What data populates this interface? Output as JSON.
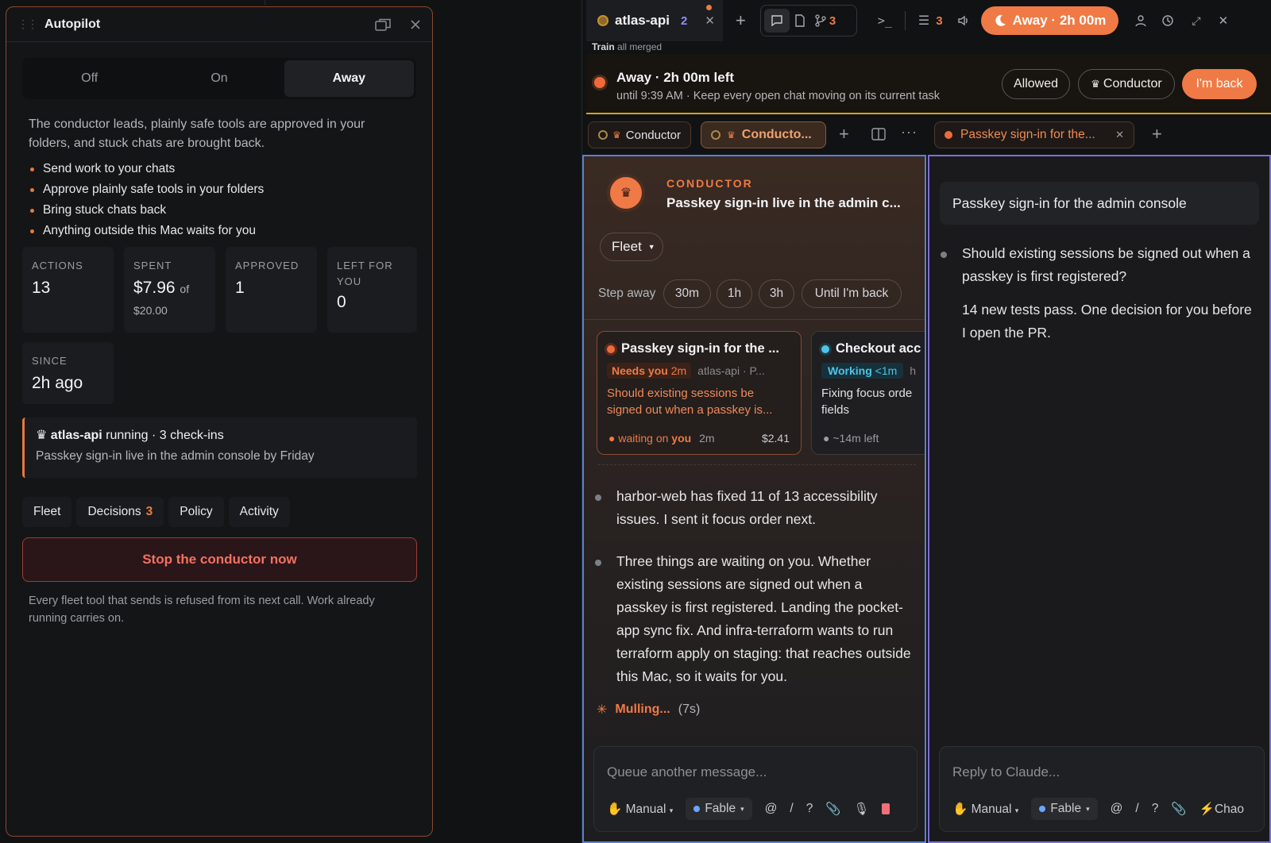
{
  "autopilot": {
    "title": "Autopilot",
    "modes": [
      "Off",
      "On",
      "Away"
    ],
    "selected_mode": "Away",
    "description": "The conductor leads, plainly safe tools are approved in your folders, and stuck chats are brought back.",
    "bullets": [
      "Send work to your chats",
      "Approve plainly safe tools in your folders",
      "Bring stuck chats back",
      "Anything outside this Mac waits for you"
    ],
    "stats": {
      "actions": {
        "label": "ACTIONS",
        "value": "13"
      },
      "spent": {
        "label": "SPENT",
        "value": "$7.96",
        "of_label": "of",
        "total": "$20.00"
      },
      "approved": {
        "label": "APPROVED",
        "value": "1"
      },
      "left": {
        "label": "LEFT FOR YOU",
        "value": "0"
      },
      "since": {
        "label": "SINCE",
        "value": "2h ago"
      }
    },
    "running": {
      "name": "atlas-api",
      "status": "running · 3 check-ins",
      "goal": "Passkey sign-in live in the admin console by Friday"
    },
    "tabs": {
      "fleet": "Fleet",
      "decisions": "Decisions",
      "decisions_count": "3",
      "policy": "Policy",
      "activity": "Activity"
    },
    "stop_label": "Stop the conductor now",
    "stop_note": "Every fleet tool that sends is refused from its next call. Work already running carries on."
  },
  "topbar": {
    "tab_name": "atlas-api",
    "tab_count": "2",
    "branch_count": "3",
    "list_count": "3",
    "away_label": "Away · 2h 00m"
  },
  "train": {
    "label": "Train",
    "status": "all merged"
  },
  "banner": {
    "title": "Away · 2h 00m left",
    "subtitle": "until 9:39 AM · Keep every open chat moving on its current task",
    "allowed": "Allowed",
    "conductor": "Conductor",
    "back": "I'm back"
  },
  "pane_tabs": {
    "t1": "Conductor",
    "t2": "Conducto...",
    "t3": "Passkey sign-in for the..."
  },
  "conductor": {
    "label": "CONDUCTOR",
    "title": "Passkey sign-in live in the admin c...",
    "fleet": "Fleet",
    "step_away": "Step away",
    "durations": [
      "30m",
      "1h",
      "3h",
      "Until I'm back"
    ],
    "cards": [
      {
        "title": "Passkey sign-in for the ...",
        "badge": "Needs you",
        "badge_time": "2m",
        "meta": "atlas-api · P...",
        "body": "Should existing sessions be signed out when a passkey is...",
        "foot_a": "waiting on",
        "foot_b": "you",
        "foot_time": "2m",
        "cost": "$2.41"
      },
      {
        "title": "Checkout acc",
        "badge": "Working",
        "badge_time": "<1m",
        "meta": "h",
        "body": "Fixing focus orde fields",
        "foot": "~14m left"
      }
    ],
    "messages": [
      "harbor-web has fixed 11 of 13 accessibility issues. I sent it focus order next.",
      "Three things are waiting on you. Whether existing sessions are signed out when a passkey is first registered. Landing the pocket-app sync fix. And infra-terraform wants to run terraform apply on staging: that reaches outside this Mac, so it waits for you."
    ],
    "mulling": "Mulling...",
    "mulling_time": "(7s)",
    "composer": {
      "placeholder": "Queue another message...",
      "mode": "Manual",
      "model": "Fable"
    }
  },
  "chat": {
    "title": "Passkey sign-in for the admin console",
    "messages": [
      "Should existing sessions be signed out when a passkey is first registered?",
      "14 new tests pass. One decision for you before I open the PR."
    ],
    "composer": {
      "placeholder": "Reply to Claude...",
      "mode": "Manual",
      "model": "Fable",
      "extra": "Chao"
    }
  },
  "colors": {
    "accent": "#ef7a45",
    "danger": "#f47063",
    "working": "#4fc3e8"
  }
}
